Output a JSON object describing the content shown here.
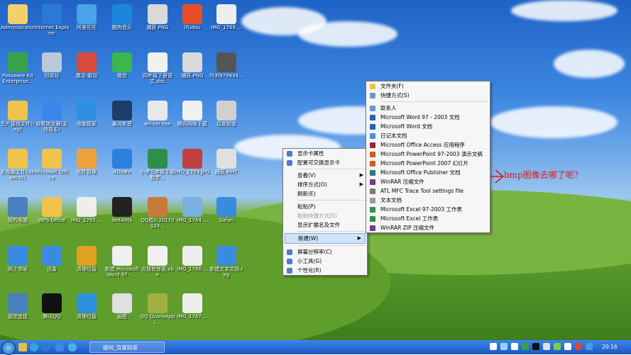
{
  "desktop_icons": [
    {
      "label": "Administrator",
      "icon": "user-folder-icon",
      "color": "#f5d06a"
    },
    {
      "label": "Internet Explorer",
      "icon": "ie-icon",
      "color": "#2a79d6"
    },
    {
      "label": "阿里旺旺",
      "icon": "aliwangwang-icon",
      "color": "#4aa3e8"
    },
    {
      "label": "酷狗音乐",
      "icon": "kugou-icon",
      "color": "#1987de"
    },
    {
      "label": "捕获.PNG",
      "icon": "image-file-icon",
      "color": "#d9d9d9"
    },
    {
      "label": "iTudou",
      "icon": "tudou-icon",
      "color": "#e84d2a"
    },
    {
      "label": "IMG_1769....",
      "icon": "image-file-icon",
      "color": "#eeeeee"
    },
    {
      "label": "Passware Kit Enterprise...",
      "icon": "passware-icon",
      "color": "#3aa24a"
    },
    {
      "label": "回收站",
      "icon": "recycle-bin-icon",
      "color": "#b8c9d8"
    },
    {
      "label": "激活-驱动",
      "icon": "folder-icon",
      "color": "#d94a3a"
    },
    {
      "label": "微信",
      "icon": "wechat-icon",
      "color": "#3cb84a"
    },
    {
      "label": "四年级下册语文.doc",
      "icon": "word-doc-icon",
      "color": "#f0f0f0"
    },
    {
      "label": "捕获.PNG",
      "icon": "image-file-icon",
      "color": "#d9d9d9"
    },
    {
      "label": "f53f879434...",
      "icon": "image-file-icon",
      "color": "#555555"
    },
    {
      "label": "生产接待文件(reg)",
      "icon": "folder-icon",
      "color": "#f0c44c"
    },
    {
      "label": "谷歌浏览器(支持双击)",
      "icon": "chrome-icon",
      "color": "#3b86e8"
    },
    {
      "label": "电脑管家",
      "icon": "pcmgr-icon",
      "color": "#2f8fe0"
    },
    {
      "label": "暴风影音",
      "icon": "baofeng-icon",
      "color": "#1d3d6a"
    },
    {
      "label": "winver.exe",
      "icon": "windows-icon",
      "color": "#e8e8e8"
    },
    {
      "label": "腾讯网络下载",
      "icon": "download-icon",
      "color": "#f0f0f0"
    },
    {
      "label": "百度知道",
      "icon": "baidu-icon",
      "color": "#d0d0d0"
    },
    {
      "label": "此电脑文件(isbaxcxc)",
      "icon": "folder-icon",
      "color": "#f0c44c"
    },
    {
      "label": "Microsoft Office",
      "icon": "folder-icon",
      "color": "#f0c44c"
    },
    {
      "label": "软件管理",
      "icon": "software-mgr-icon",
      "color": "#f0a23a"
    },
    {
      "label": "ADsafe",
      "icon": "adsafe-icon",
      "color": "#2f7fe0"
    },
    {
      "label": "小学三年级下期数学...",
      "icon": "excel-file-icon",
      "color": "#2f8f4a"
    },
    {
      "label": "IMG_1763.JPG",
      "icon": "image-file-icon",
      "color": "#c04040"
    },
    {
      "label": "捕获.MHT",
      "icon": "mht-file-icon",
      "color": "#e0e0e0"
    },
    {
      "label": "我的电脑",
      "icon": "my-computer-icon",
      "color": "#4a7fc0"
    },
    {
      "label": "WPS Office",
      "icon": "folder-icon",
      "color": "#f0c44c"
    },
    {
      "label": "IMG_1765....",
      "icon": "image-file-icon",
      "color": "#eeeeee"
    },
    {
      "label": "NetAnts",
      "icon": "netants-icon",
      "color": "#222222"
    },
    {
      "label": "QQ图片20170124...",
      "icon": "image-file-icon",
      "color": "#c87a3a"
    },
    {
      "label": "IMG_1764....",
      "icon": "image-file-icon",
      "color": "#7ab0e0"
    },
    {
      "label": "Safari",
      "icon": "safari-icon",
      "color": "#3a8ae0"
    },
    {
      "label": "网上邻居",
      "icon": "network-icon",
      "color": "#3a8ae0"
    },
    {
      "label": "迅雷",
      "icon": "xunlei-icon",
      "color": "#3a8ae0"
    },
    {
      "label": "清理垃圾",
      "icon": "cleanup-icon",
      "color": "#e0a020"
    },
    {
      "label": "新建 Microsoft Word 97 - ...",
      "icon": "word-doc-icon",
      "color": "#f0f0f0"
    },
    {
      "label": "点我有惊喜.vbe",
      "icon": "vbe-file-icon",
      "color": "#f0f0f0"
    },
    {
      "label": "IMG_1766....",
      "icon": "image-file-icon",
      "color": "#eeeeee"
    },
    {
      "label": "新建文本文档.reg",
      "icon": "reg-file-icon",
      "color": "#3a8ae0"
    },
    {
      "label": "宽带连接",
      "icon": "broadband-icon",
      "color": "#4a7fc0"
    },
    {
      "label": "腾讯QQ",
      "icon": "qq-icon",
      "color": "#111111"
    },
    {
      "label": "清理垃圾",
      "icon": "pcmgr-icon",
      "color": "#2f8fe0"
    },
    {
      "label": "画图",
      "icon": "paint-icon",
      "color": "#e0e0e0"
    },
    {
      "label": "QQ QzoneApp(...",
      "icon": "image-file-icon",
      "color": "#a0b040"
    },
    {
      "label": "IMG_1767....",
      "icon": "image-file-icon",
      "color": "#eeeeee"
    }
  ],
  "context_menu": {
    "items": [
      {
        "label": "显示卡属性",
        "icon": "display-props-icon",
        "disabled": false,
        "submenu": false
      },
      {
        "label": "配置可交换显示卡",
        "icon": "display-switch-icon",
        "disabled": false,
        "submenu": false
      },
      {
        "sep": true
      },
      {
        "label": "查看(V)",
        "icon": "",
        "disabled": false,
        "submenu": true
      },
      {
        "label": "排序方式(O)",
        "icon": "",
        "disabled": false,
        "submenu": true
      },
      {
        "label": "刷新(E)",
        "icon": "",
        "disabled": false,
        "submenu": false
      },
      {
        "sep": true
      },
      {
        "label": "粘贴(P)",
        "icon": "",
        "disabled": false,
        "submenu": false
      },
      {
        "label": "粘贴快捷方式(S)",
        "icon": "",
        "disabled": true,
        "submenu": false
      },
      {
        "label": "显示扩展名及文件",
        "icon": "",
        "disabled": false,
        "submenu": false
      },
      {
        "sep": true
      },
      {
        "label": "新建(W)",
        "icon": "",
        "disabled": false,
        "submenu": true,
        "highlight": true
      },
      {
        "sep": true
      },
      {
        "label": "屏幕分辨率(C)",
        "icon": "resolution-icon",
        "disabled": false,
        "submenu": false
      },
      {
        "label": "小工具(G)",
        "icon": "gadgets-icon",
        "disabled": false,
        "submenu": false
      },
      {
        "label": "个性化(R)",
        "icon": "personalize-icon",
        "disabled": false,
        "submenu": false
      }
    ]
  },
  "new_submenu": {
    "items": [
      {
        "label": "文件夹(F)",
        "icon": "folder-icon",
        "color": "#f0c44c"
      },
      {
        "label": "快捷方式(S)",
        "icon": "shortcut-icon",
        "color": "#6a9ad0"
      },
      {
        "sep": true
      },
      {
        "label": "联系人",
        "icon": "contact-icon",
        "color": "#6a9ad0"
      },
      {
        "label": "Microsoft Word 97 - 2003 文档",
        "icon": "word-doc-icon",
        "color": "#2b5fb4"
      },
      {
        "label": "Microsoft Word 文档",
        "icon": "word-doc-icon",
        "color": "#2b5fb4"
      },
      {
        "label": "日记本文档",
        "icon": "journal-icon",
        "color": "#4a90d0"
      },
      {
        "label": "Microsoft Office Access 应用程序",
        "icon": "access-icon",
        "color": "#a02040"
      },
      {
        "label": "Microsoft PowerPoint 97-2003 演示文稿",
        "icon": "powerpoint-icon",
        "color": "#d05a20"
      },
      {
        "label": "Microsoft PowerPoint 2007 幻灯片",
        "icon": "powerpoint-icon",
        "color": "#d05a20"
      },
      {
        "label": "Microsoft Office Publisher 文档",
        "icon": "publisher-icon",
        "color": "#2a7a7a"
      },
      {
        "label": "WinRAR 压缩文件",
        "icon": "winrar-icon",
        "color": "#7a3a8a"
      },
      {
        "label": "ATL MFC Trace Tool settings file",
        "icon": "settings-file-icon",
        "color": "#7a7a7a"
      },
      {
        "label": "文本文档",
        "icon": "text-file-icon",
        "color": "#9a9a9a"
      },
      {
        "label": "Microsoft Excel 97-2003 工作表",
        "icon": "excel-file-icon",
        "color": "#2f8f4a"
      },
      {
        "label": "Microsoft Excel 工作表",
        "icon": "excel-file-icon",
        "color": "#2f8f4a"
      },
      {
        "label": "WinRAR ZIP 压缩文件",
        "icon": "winrar-icon",
        "color": "#7a3a8a"
      }
    ]
  },
  "annotation": {
    "text": "bmp图像去哪了呢？",
    "color": "#e01818"
  },
  "taskbar": {
    "task_label": "提问_百度知道",
    "clock": "20:16",
    "tray_icons": [
      "tray-up-icon",
      "tray-network-icon",
      "tray-volume-icon",
      "tray-security-icon",
      "tray-qq-icon",
      "tray-ime-icon",
      "tray-battery-icon",
      "tray-flag-icon",
      "tray-antivirus-icon",
      "tray-update-icon"
    ]
  }
}
